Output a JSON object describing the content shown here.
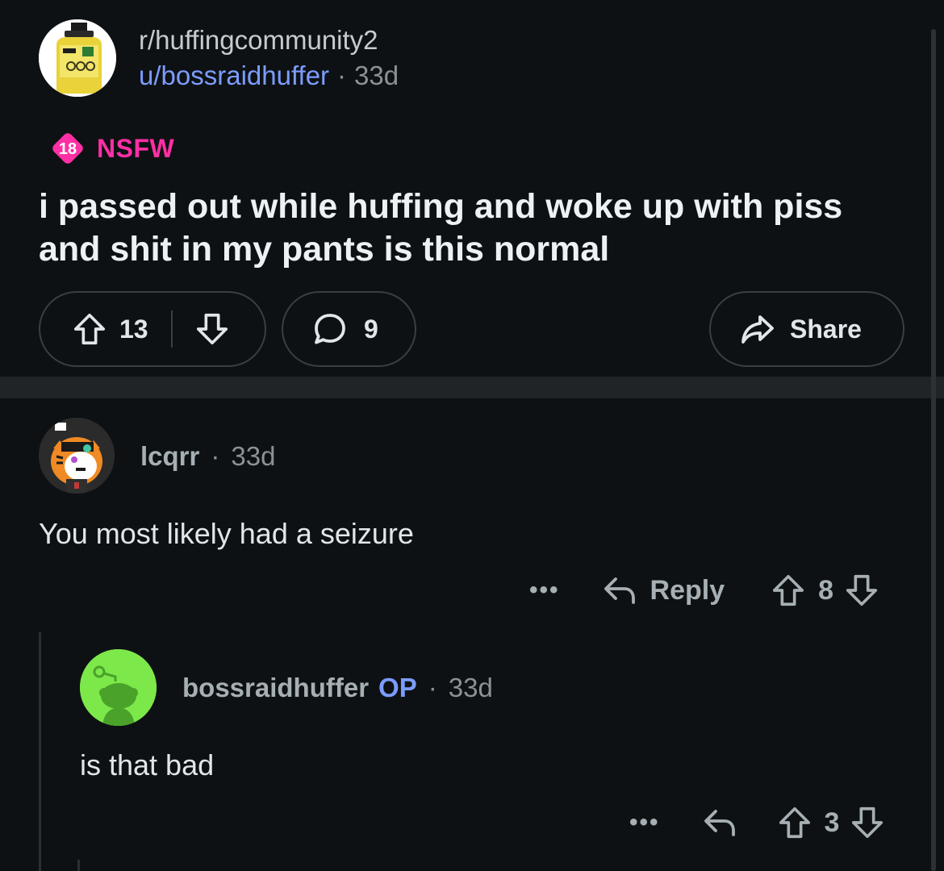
{
  "post": {
    "subreddit": "r/huffingcommunity2",
    "author": "u/bossraidhuffer",
    "age": "33d",
    "nsfw_badge": "18",
    "nsfw_label": "NSFW",
    "title": "i passed out while huffing and woke up with piss and shit in my pants is this normal",
    "upvotes": "13",
    "comments": "9",
    "share_label": "Share"
  },
  "comments": [
    {
      "username": "lcqrr",
      "age": "33d",
      "body": "You most likely had a seizure",
      "more": "•••",
      "reply_label": "Reply",
      "score": "8"
    },
    {
      "username": "bossraidhuffer",
      "op_tag": "OP",
      "age": "33d",
      "body": "is that bad",
      "more": "•••",
      "score": "3"
    }
  ],
  "colors": {
    "background": "#0e1113",
    "accent_blue": "#7c9cff",
    "nsfw_pink": "#ff2fa5",
    "avatar_green": "#7ce84a"
  }
}
